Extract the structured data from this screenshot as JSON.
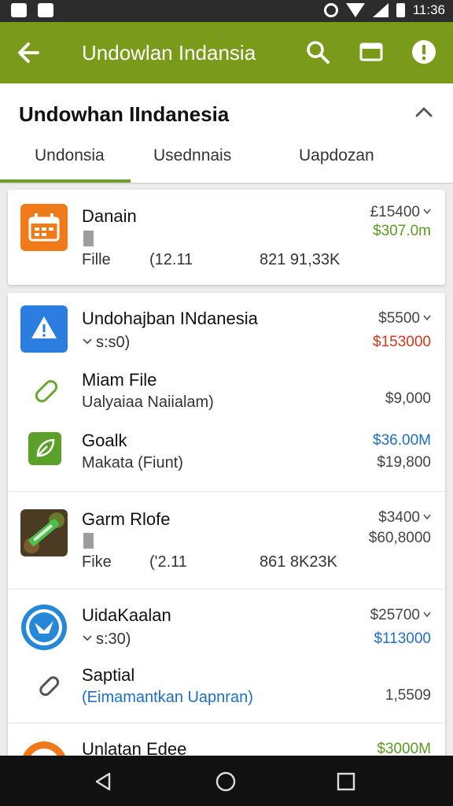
{
  "status": {
    "time": "11:36"
  },
  "appbar": {
    "title": "Undowlan Indansia"
  },
  "header": {
    "title": "Undowhan IIndanesia",
    "tabs": [
      "Undonsia",
      "Usednnais",
      "Uapdozan"
    ]
  },
  "cards": [
    {
      "rows": [
        {
          "name": "Danain",
          "bottom_left": "Fille",
          "bottom_mid": "(12.11",
          "bottom_right": "821 91,33K",
          "right_top": "£15400",
          "right_mid": "$307.0m"
        }
      ]
    },
    {
      "rows": [
        {
          "name": "Undohajban INdanesia",
          "sub": "s:s0)",
          "right_top": "$5500",
          "right_mid": "$153000"
        },
        {
          "name": "Miam File",
          "sub": "Ualyaiaa Naiialam)",
          "right_mid": "$9,000"
        },
        {
          "name": "Goalk",
          "sub": "Makata (Fiunt)",
          "right_top": "$36.00M",
          "right_mid": "$19,800"
        },
        {
          "name": "Garm Rlofe",
          "bottom_left": "Fike",
          "bottom_mid": "('2.11",
          "bottom_right": "861 8K23K",
          "right_top": "$3400",
          "right_mid": "$60,8000"
        },
        {
          "name": "UidaKaalan",
          "sub": "s:30)",
          "right_top": "$25700",
          "right_mid": "$113000"
        },
        {
          "name": "Saptial",
          "sub": "(Eimamantkan Uapnran)",
          "right_mid": "1,5509"
        },
        {
          "name": "Unlatan Edee",
          "right_top": "$3000M"
        }
      ]
    }
  ],
  "colors": {
    "appbar": "#7a9b1a",
    "accent": "#6b9d2a"
  }
}
